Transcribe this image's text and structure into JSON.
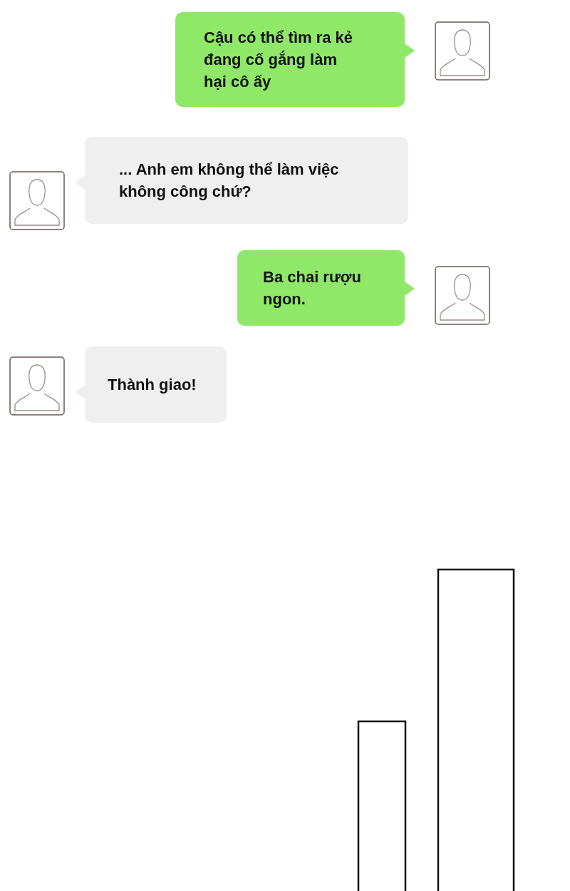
{
  "messages": [
    {
      "kind": "sent",
      "text": "Cậu có thể tìm ra kẻ đang cố gắng làm hại cô ấy"
    },
    {
      "kind": "received",
      "text": "... Anh em không thể làm việc không công chứ?"
    },
    {
      "kind": "sent",
      "text": "Ba chai rượu ngon."
    },
    {
      "kind": "received",
      "text": "Thành giao!"
    }
  ]
}
